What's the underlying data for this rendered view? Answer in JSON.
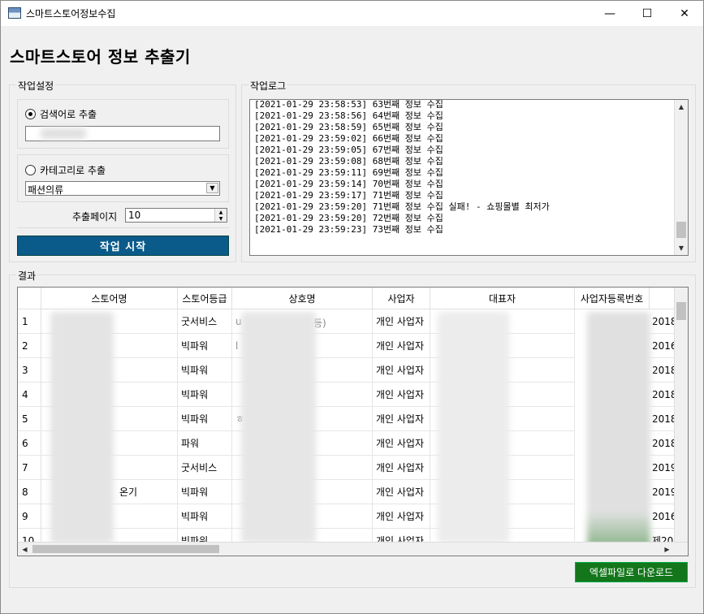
{
  "window": {
    "title": "스마트스토어정보수집",
    "minimize": "—",
    "maximize": "☐",
    "close": "✕"
  },
  "heading": "스마트스토어 정보 추출기",
  "settings": {
    "group_label": "작업설정",
    "keyword_radio_label": "검색어로 추출",
    "keyword_selected": true,
    "category_radio_label": "카테고리로 추출",
    "category_selected": false,
    "category_value": "패션의류",
    "pages_label": "추출페이지",
    "pages_value": "10",
    "start_button": "작업 시작"
  },
  "log": {
    "group_label": "작업로그",
    "lines": [
      "[2021-01-29 23:58:53] 63번째 정보 수집",
      "[2021-01-29 23:58:56] 64번째 정보 수집",
      "[2021-01-29 23:58:59] 65번째 정보 수집",
      "[2021-01-29 23:59:02] 66번째 정보 수집",
      "[2021-01-29 23:59:05] 67번째 정보 수집",
      "[2021-01-29 23:59:08] 68번째 정보 수집",
      "[2021-01-29 23:59:11] 69번째 정보 수집",
      "[2021-01-29 23:59:14] 70번째 정보 수집",
      "[2021-01-29 23:59:17] 71번째 정보 수집",
      "[2021-01-29 23:59:20] 71번째 정보 수집 실패! - 쇼핑몰별 최저가",
      "[2021-01-29 23:59:20] 72번째 정보 수집",
      "[2021-01-29 23:59:23] 73번째 정보 수집"
    ]
  },
  "results": {
    "group_label": "결과",
    "columns": [
      "스토어명",
      "스토어등급",
      "상호명",
      "사업자",
      "대표자",
      "사업자등록번호"
    ],
    "rows": [
      {
        "num": "1",
        "store": "",
        "grade": "굿서비스",
        "company": "u",
        "company_tail": "등)",
        "biz": "개인 사업자",
        "rep": "",
        "regno": "2018"
      },
      {
        "num": "2",
        "store": "",
        "grade": "빅파워",
        "company": "l",
        "company_tail": "",
        "biz": "개인 사업자",
        "rep": "",
        "regno": "2016"
      },
      {
        "num": "3",
        "store": "",
        "grade": "빅파워",
        "company": "",
        "company_tail": "",
        "biz": "개인 사업자",
        "rep": "",
        "regno": "2018"
      },
      {
        "num": "4",
        "store": "",
        "grade": "빅파워",
        "company": "",
        "company_tail": "",
        "biz": "개인 사업자",
        "rep": "",
        "regno": "2018"
      },
      {
        "num": "5",
        "store": "",
        "grade": "빅파워",
        "company": "ㅎ",
        "company_tail": "",
        "biz": "개인 사업자",
        "rep": "",
        "regno": "2018"
      },
      {
        "num": "6",
        "store": "",
        "grade": "파워",
        "company": "",
        "company_tail": "",
        "biz": "개인 사업자",
        "rep": "",
        "regno": "2018"
      },
      {
        "num": "7",
        "store": "",
        "grade": "굿서비스",
        "company": "",
        "company_tail": "",
        "biz": "개인 사업자",
        "rep": "",
        "regno": "2019"
      },
      {
        "num": "8",
        "store": "온기",
        "grade": "빅파워",
        "company": "",
        "company_tail": "",
        "biz": "개인 사업자",
        "rep": "",
        "regno": "2019"
      },
      {
        "num": "9",
        "store": "",
        "grade": "빅파워",
        "company": "",
        "company_tail": "",
        "biz": "개인 사업자",
        "rep": "",
        "regno": "2016"
      },
      {
        "num": "10",
        "store": "",
        "grade": "빅파워",
        "company": "",
        "company_tail": "",
        "biz": "개인 사업자",
        "rep": "",
        "regno": "제20"
      }
    ],
    "download_button": "엑셀파일로 다운로드"
  }
}
